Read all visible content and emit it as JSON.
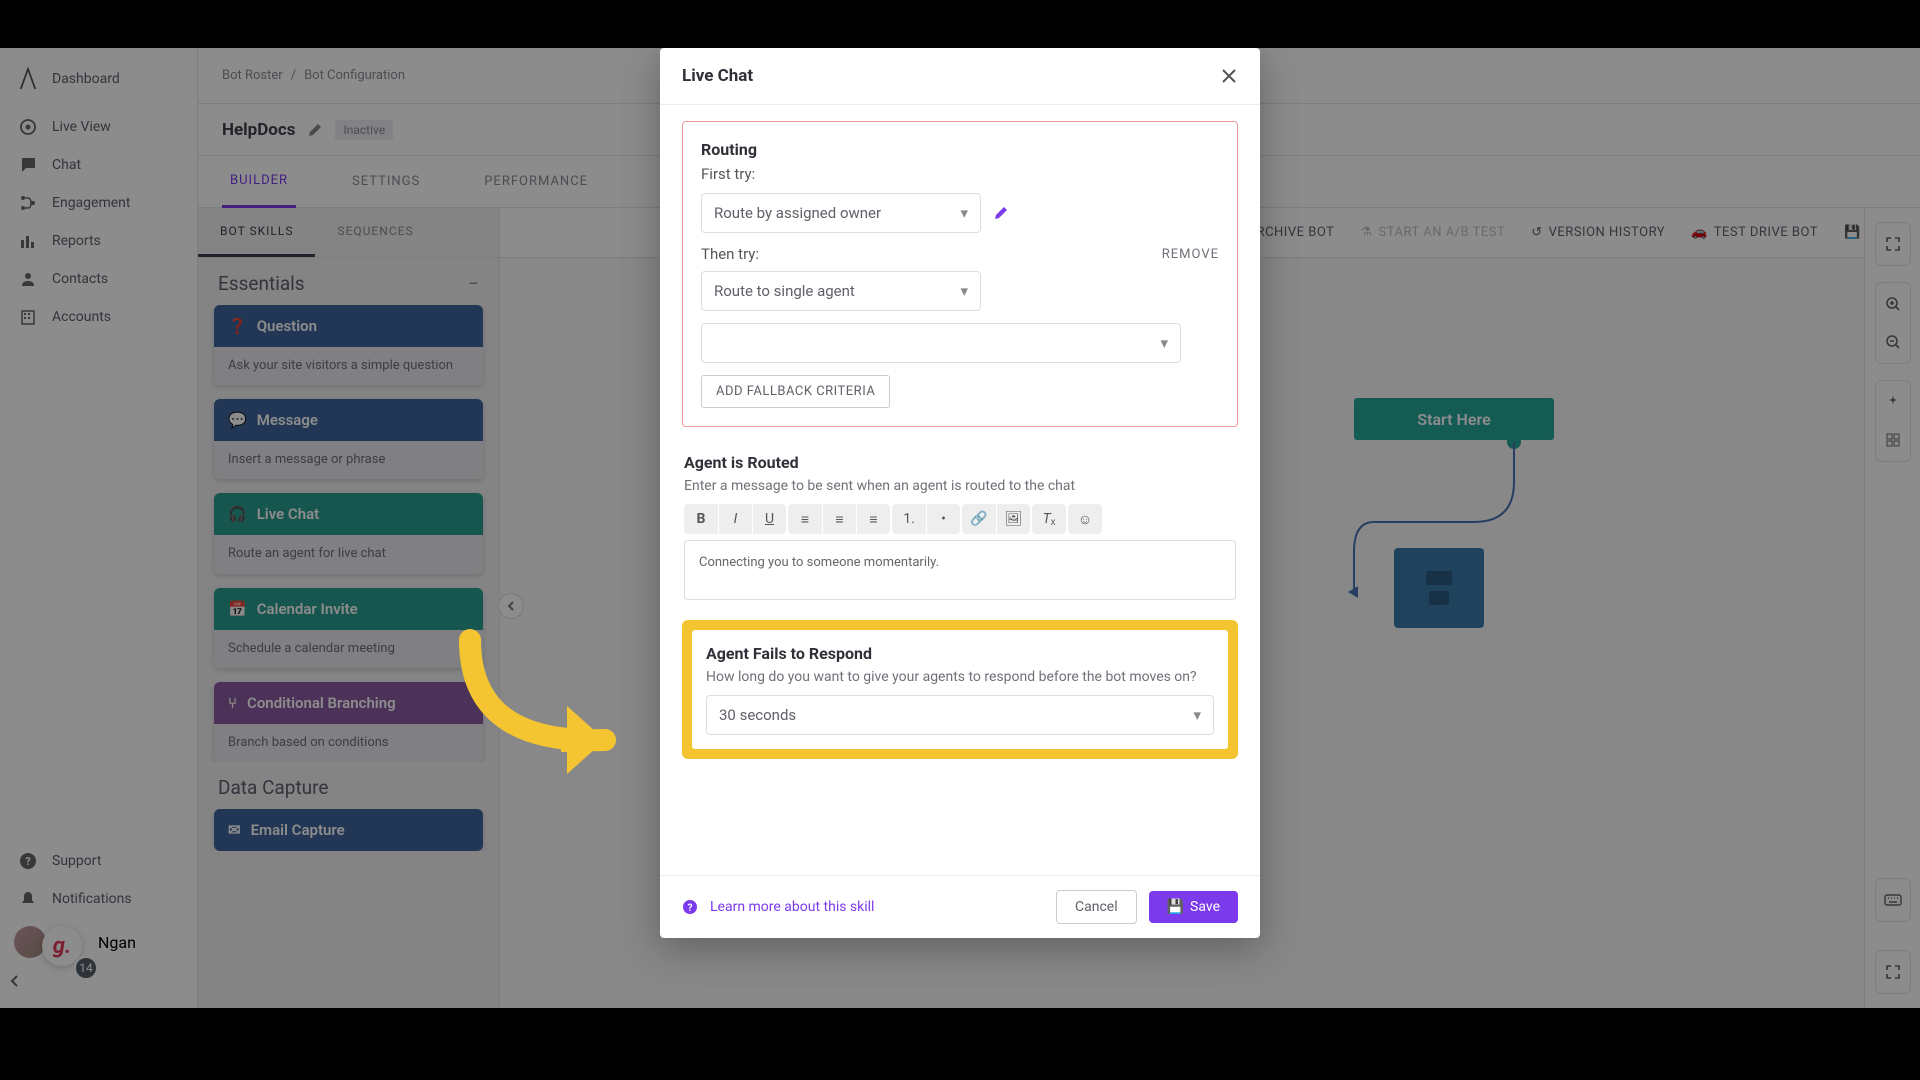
{
  "sidebar": {
    "items": [
      {
        "label": "Dashboard",
        "icon": "logo"
      },
      {
        "label": "Live View",
        "icon": "target"
      },
      {
        "label": "Chat",
        "icon": "chat"
      },
      {
        "label": "Engagement",
        "icon": "branch"
      },
      {
        "label": "Reports",
        "icon": "bar"
      },
      {
        "label": "Contacts",
        "icon": "user"
      },
      {
        "label": "Accounts",
        "icon": "building"
      }
    ],
    "bottom": {
      "support": "Support",
      "notifications": "Notifications",
      "username": "Ngan",
      "badge": "14"
    }
  },
  "breadcrumb": {
    "root": "Bot Roster",
    "current": "Bot Configuration"
  },
  "bot": {
    "name": "HelpDocs",
    "status": "Inactive"
  },
  "tabs": [
    "BUILDER",
    "SETTINGS",
    "PERFORMANCE"
  ],
  "toolbar": {
    "archive": "ARCHIVE BOT",
    "ab": "START AN A/B TEST",
    "version": "VERSION HISTORY",
    "test": "TEST DRIVE BOT",
    "save": "SAVE"
  },
  "skill_panel": {
    "tabs": [
      "BOT SKILLS",
      "SEQUENCES"
    ],
    "sections": {
      "essentials": "Essentials",
      "data_capture": "Data Capture"
    },
    "cards": [
      {
        "title": "Question",
        "desc": "Ask your site visitors a simple question",
        "color": "blue",
        "icon": "?"
      },
      {
        "title": "Message",
        "desc": "Insert a message or phrase",
        "color": "blue",
        "icon": "msg"
      },
      {
        "title": "Live Chat",
        "desc": "Route an agent for live chat",
        "color": "green",
        "icon": "headset"
      },
      {
        "title": "Calendar Invite",
        "desc": "Schedule a calendar meeting",
        "color": "green",
        "icon": "cal"
      },
      {
        "title": "Conditional Branching",
        "desc": "Branch based on conditions",
        "color": "purple",
        "icon": "branch"
      },
      {
        "title": "Email Capture",
        "desc": "",
        "color": "blue",
        "icon": "mail"
      }
    ]
  },
  "canvas": {
    "start": "Start Here"
  },
  "modal": {
    "title": "Live Chat",
    "routing": {
      "heading": "Routing",
      "first_try_label": "First try:",
      "first_select": "Route by assigned owner",
      "then_try_label": "Then try:",
      "remove": "REMOVE",
      "second_select": "Route to single agent",
      "third_select": "",
      "fallback_btn": "ADD FALLBACK CRITERIA"
    },
    "agent_routed": {
      "heading": "Agent is Routed",
      "sub": "Enter a message to be sent when an agent is routed to the chat",
      "message": "Connecting you to someone momentarily."
    },
    "agent_fails": {
      "heading": "Agent Fails to Respond",
      "sub": "How long do you want to give your agents to respond before the bot moves on?",
      "select": "30 seconds"
    },
    "footer": {
      "learn": "Learn more about this skill",
      "cancel": "Cancel",
      "save": "Save"
    }
  }
}
